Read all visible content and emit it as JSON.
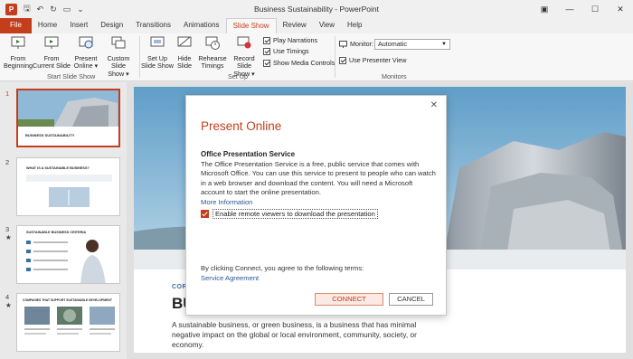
{
  "titlebar": {
    "title": "Business Sustainability  -  PowerPoint",
    "logo_letter": "P",
    "minimize": "—",
    "maximize": "☐",
    "close": "✕",
    "ribbon_display": "▣"
  },
  "tabs": [
    "File",
    "Home",
    "Insert",
    "Design",
    "Transitions",
    "Animations",
    "Slide Show",
    "Review",
    "View",
    "Help"
  ],
  "ribbon": {
    "start_group": {
      "label": "Start Slide Show",
      "from_beginning_1": "From",
      "from_beginning_2": "Beginning",
      "from_current_1": "From",
      "from_current_2": "Current Slide",
      "present_online_1": "Present",
      "present_online_2": "Online ▾",
      "custom_show_1": "Custom Slide",
      "custom_show_2": "Show ▾"
    },
    "setup_group": {
      "label": "Set Up",
      "setup_show_1": "Set Up",
      "setup_show_2": "Slide Show",
      "hide_slide_1": "Hide",
      "hide_slide_2": "Slide",
      "rehearse_1": "Rehearse",
      "rehearse_2": "Timings",
      "record_1": "Record Slide",
      "record_2": "Show ▾",
      "play_narrations": "Play Narrations",
      "use_timings": "Use Timings",
      "show_media_controls": "Show Media Controls"
    },
    "monitors_group": {
      "label": "Monitors",
      "monitor_label": "Monitor:",
      "monitor_value": "Automatic",
      "use_presenter_view": "Use Presenter View"
    }
  },
  "thumbnails": [
    {
      "num": "1",
      "star": "",
      "title": "BUSINESS SUSTAINABILITY"
    },
    {
      "num": "2",
      "star": "",
      "title": "WHAT IS A SUSTAINABLE BUSINESS?"
    },
    {
      "num": "3",
      "star": "★",
      "title": "SUSTAINABLE BUSINESS CRITERIA"
    },
    {
      "num": "4",
      "star": "★",
      "title": "COMPANIES THAT SUPPORT SUSTAINABLE DEVELOPMENT"
    }
  ],
  "slide": {
    "kicker": "CORE",
    "big_title": "BU",
    "paragraph": "A sustainable business, or green business, is a business that has minimal negative impact on the global or local environment, community, society, or economy."
  },
  "dialog": {
    "close": "✕",
    "title": "Present Online",
    "service_heading": "Office Presentation Service",
    "description": "The Office Presentation Service is a free, public service that comes with Microsoft Office. You can use this service to present to people who can watch in a web browser and download the content. You will need a Microsoft account to start the online presentation.",
    "more_info": "More Information",
    "enable_download": "Enable remote viewers to download the presentation",
    "terms": "By clicking Connect, you agree to the following terms:",
    "service_agreement": "Service Agreement",
    "connect": "CONNECT",
    "cancel": "CANCEL"
  },
  "colors": {
    "accent": "#c43e1c",
    "link": "#2b5797"
  }
}
